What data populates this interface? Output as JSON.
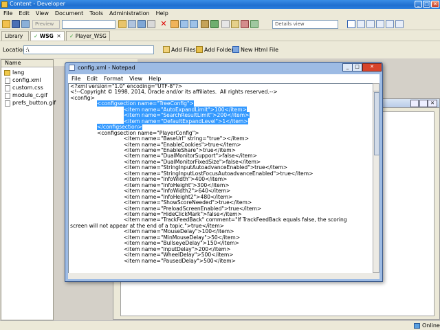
{
  "app": {
    "title": "Content - Developer",
    "menu": [
      "File",
      "Edit",
      "View",
      "Document",
      "Tools",
      "Administration",
      "Help"
    ],
    "toolbar": {
      "preview_label": "Preview",
      "view_select": "Details view"
    },
    "tabs": [
      {
        "label": "Library"
      },
      {
        "label": "WSG"
      },
      {
        "label": "Player_WSG"
      }
    ],
    "location": {
      "label": "Location:",
      "value": ":\\",
      "buttons": [
        "Add Files",
        "Add Folder",
        "New Html File"
      ]
    },
    "file_list": {
      "header": "Name",
      "items": [
        "lang",
        "config.xml",
        "custom.css",
        "module_c.gif",
        "prefs_button.gif"
      ]
    },
    "status": "Online"
  },
  "notepad": {
    "title": "config.xml - Notepad",
    "menu": [
      "File",
      "Edit",
      "Format",
      "View",
      "Help"
    ],
    "lines": [
      {
        "text": "<?xml version=\"1.0\" encoding=\"UTF-8\"?>",
        "indent": 0
      },
      {
        "text": "<!--Copyright © 1998, 2014, Oracle and/or its affiliates.  All rights reserved.-->",
        "indent": 0
      },
      {
        "text": "<config>",
        "indent": 0
      },
      {
        "text": "<configsection name=\"TreeConfig\">",
        "indent": 1,
        "sel": true
      },
      {
        "text": "<item name=\"AutoExpandLimit\">100</item>",
        "indent": 2,
        "sel": true
      },
      {
        "text": "<item name=\"SearchResultLimit\">200</item>",
        "indent": 2,
        "sel": true
      },
      {
        "text": "<item name=\"DefaultExpandLevel\">1</item>",
        "indent": 2,
        "sel": true
      },
      {
        "text": "</configsection>",
        "indent": 1,
        "sel": true
      },
      {
        "text": "<configsection name=\"PlayerConfig\">",
        "indent": 1
      },
      {
        "text": "<item name=\"BaseUrl\" string=\"true\"></item>",
        "indent": 2
      },
      {
        "text": "<item name=\"EnableCookies\">true</item>",
        "indent": 2
      },
      {
        "text": "<item name=\"EnableShare\">true</item>",
        "indent": 2
      },
      {
        "text": "<item name=\"DualMonitorSupport\">false</item>",
        "indent": 2
      },
      {
        "text": "<item name=\"DualMonitorFixedSize\">false</item>",
        "indent": 2
      },
      {
        "text": "<item name=\"StringInputAutoadvanceEnabled\">true</item>",
        "indent": 2
      },
      {
        "text": "<item name=\"StringInputLostFocusAutoadvanceEnabled\">true</item>",
        "indent": 2
      },
      {
        "text": "<item name=\"InfoWidth\">400</item>",
        "indent": 2
      },
      {
        "text": "<item name=\"InfoHeight\">300</item>",
        "indent": 2
      },
      {
        "text": "<item name=\"InfoWidth2\">640</item>",
        "indent": 2
      },
      {
        "text": "<item name=\"InfoHeight2\">480</item>",
        "indent": 2
      },
      {
        "text": "<item name=\"ShowScoreNeeded\">true</item>",
        "indent": 2
      },
      {
        "text": "<item name=\"PreloadScreenEnabled\">true</item>",
        "indent": 2
      },
      {
        "text": "<item name=\"HideClickMark\">false</item>",
        "indent": 2
      },
      {
        "text": "<item name=\"TrackFeedBack\" comment=\"If TrackFeedBack equals false, the scoring",
        "indent": 2
      },
      {
        "text": "screen will not appear at the end of a topic.\">true</item>",
        "indent": 0
      },
      {
        "text": "<item name=\"MouseDelay\">100</item>",
        "indent": 2
      },
      {
        "text": "<item name=\"MinMouseDelay\">50</item>",
        "indent": 2
      },
      {
        "text": "<item name=\"BullseyeDelay\">150</item>",
        "indent": 2
      },
      {
        "text": "<item name=\"InputDelay\">200</item>",
        "indent": 2
      },
      {
        "text": "<item name=\"WheelDelay\">500</item>",
        "indent": 2
      },
      {
        "text": "<item name=\"PausedDelay\">500</item>",
        "indent": 2
      }
    ]
  },
  "colors": {
    "titlebar": "#2b7fde",
    "selection": "#3399ff",
    "chrome": "#ece9d8"
  }
}
